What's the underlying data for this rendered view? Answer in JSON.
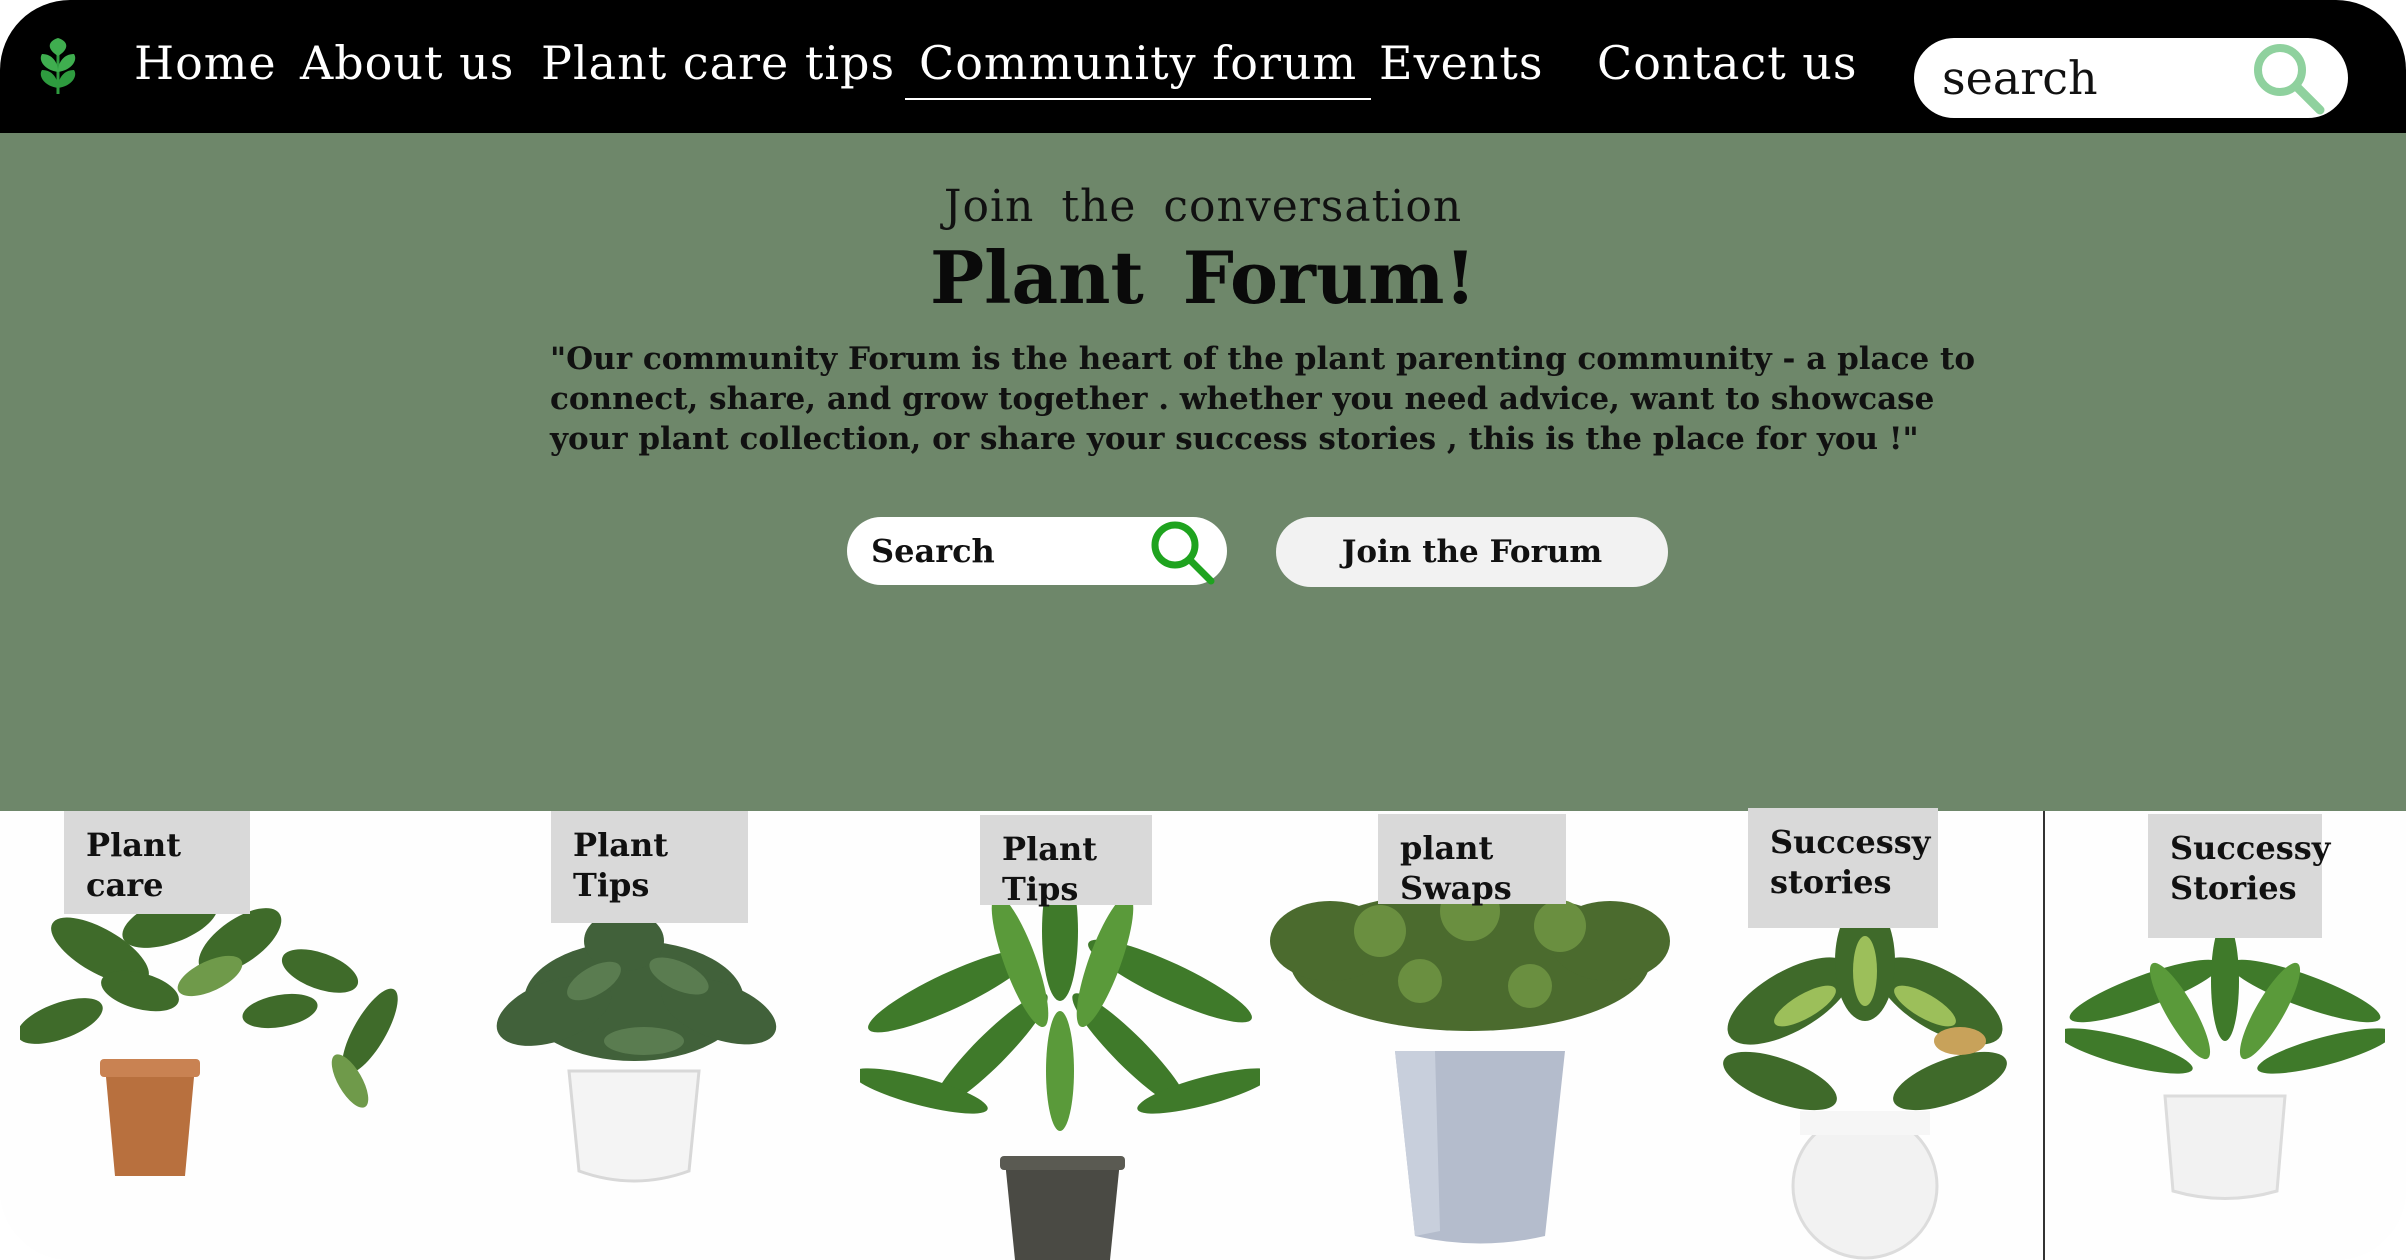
{
  "nav": {
    "logo_icon": "leaf-sprout-icon",
    "links": [
      "Home",
      "About us",
      "Plant care tips",
      "Community forum",
      "Events",
      "Contact us"
    ],
    "active": "Community forum",
    "search_placeholder": "search",
    "search_icon": "search-icon"
  },
  "hero": {
    "kicker": "Join  the  conversation",
    "title": "Plant  Forum!",
    "description": "\"Our community Forum is the heart of the plant parenting community - a place to connect, share, and grow together .  whether  you need advice, want to showcase your plant collection, or share your success stories , this is the place for you !\"",
    "search_placeholder": "Search",
    "join_button": "Join the Forum"
  },
  "cards": [
    {
      "label": "Plant\ncare"
    },
    {
      "label": "Plant\nTips"
    },
    {
      "label": "Plant\nTips"
    },
    {
      "label": "plant\nSwaps"
    },
    {
      "label": "Successy\nstories"
    },
    {
      "label": "Successy\nStories"
    }
  ],
  "colors": {
    "nav_bg": "#000000",
    "hero_bg": "#6e876a",
    "accent_green": "#1fa31f",
    "search_icon_light": "#8fd19e",
    "label_bg": "#d9d9d9"
  }
}
